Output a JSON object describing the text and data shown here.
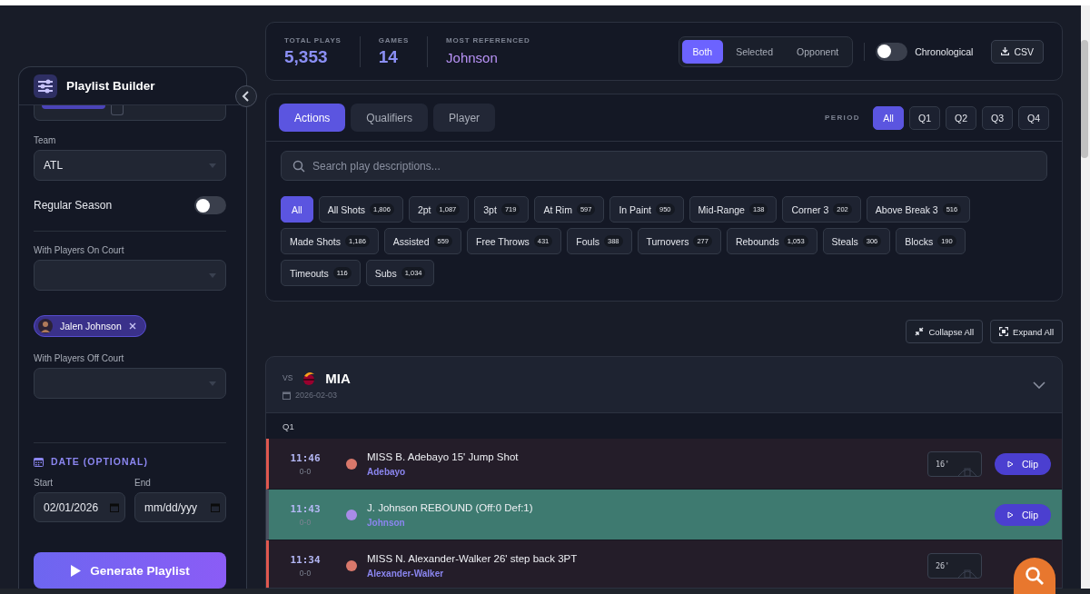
{
  "sidebar": {
    "title": "Playlist Builder",
    "team": {
      "label": "Team",
      "value": "ATL"
    },
    "regular_season": {
      "label": "Regular Season",
      "on": false
    },
    "on_court": {
      "label": "With Players On Court",
      "chips": [
        "Jalen Johnson"
      ]
    },
    "off_court": {
      "label": "With Players Off Court"
    },
    "date": {
      "heading": "DATE (OPTIONAL)",
      "start": {
        "label": "Start",
        "value": "02/01/2026"
      },
      "end": {
        "label": "End",
        "placeholder": "mm/dd/yyy"
      }
    },
    "generate_button": "Generate Playlist"
  },
  "stats": [
    {
      "label": "TOTAL PLAYS",
      "value": "5,353"
    },
    {
      "label": "GAMES",
      "value": "14"
    },
    {
      "label": "MOST REFERENCED",
      "value": "Johnson",
      "kind": "name"
    }
  ],
  "scope": [
    {
      "label": "Both",
      "selected": true
    },
    {
      "label": "Selected",
      "selected": false
    },
    {
      "label": "Opponent",
      "selected": false
    }
  ],
  "chronological": {
    "label": "Chronological",
    "on": false
  },
  "csv_button": "CSV",
  "tabs": [
    {
      "label": "Actions",
      "selected": true
    },
    {
      "label": "Qualifiers",
      "selected": false
    },
    {
      "label": "Player",
      "selected": false
    }
  ],
  "period": {
    "label": "PERIOD",
    "options": [
      {
        "label": "All",
        "selected": true
      },
      {
        "label": "Q1",
        "selected": false
      },
      {
        "label": "Q2",
        "selected": false
      },
      {
        "label": "Q3",
        "selected": false
      },
      {
        "label": "Q4",
        "selected": false
      }
    ]
  },
  "search": {
    "placeholder": "Search play descriptions..."
  },
  "filters": [
    {
      "label": "All",
      "selected": true
    },
    {
      "label": "All Shots",
      "count": "1,806",
      "selected": false
    },
    {
      "label": "2pt",
      "count": "1,087",
      "selected": false
    },
    {
      "label": "3pt",
      "count": "719",
      "selected": false
    },
    {
      "label": "At Rim",
      "count": "597",
      "selected": false
    },
    {
      "label": "In Paint",
      "count": "950",
      "selected": false
    },
    {
      "label": "Mid-Range",
      "count": "138",
      "selected": false
    },
    {
      "label": "Corner 3",
      "count": "202",
      "selected": false
    },
    {
      "label": "Above Break 3",
      "count": "516",
      "selected": false
    },
    {
      "label": "Made Shots",
      "count": "1,186",
      "selected": false
    },
    {
      "label": "Assisted",
      "count": "559",
      "selected": false
    },
    {
      "label": "Free Throws",
      "count": "431",
      "selected": false
    },
    {
      "label": "Fouls",
      "count": "388",
      "selected": false
    },
    {
      "label": "Turnovers",
      "count": "277",
      "selected": false
    },
    {
      "label": "Rebounds",
      "count": "1,053",
      "selected": false
    },
    {
      "label": "Steals",
      "count": "306",
      "selected": false
    },
    {
      "label": "Blocks",
      "count": "190",
      "selected": false
    },
    {
      "label": "Timeouts",
      "count": "116",
      "selected": false
    },
    {
      "label": "Subs",
      "count": "1,034",
      "selected": false
    }
  ],
  "collapse_button": "Collapse All",
  "expand_button": "Expand All",
  "game": {
    "vs": "VS",
    "team": "MIA",
    "date": "2026-02-03",
    "expanded": true,
    "period": "Q1",
    "plays": [
      {
        "time": "11:46",
        "score": "0-0",
        "color": "#d9786b",
        "description": "MISS B. Adebayo 15' Jump Shot",
        "player": "Adebayo",
        "distance": "16'",
        "kind": "miss",
        "selected": false,
        "clip": "Clip"
      },
      {
        "time": "11:43",
        "score": "0-0",
        "color": "#a98be8",
        "description": "J. Johnson REBOUND (Off:0 Def:1)",
        "player": "Johnson",
        "kind": "other",
        "selected": true,
        "clip": "Clip"
      },
      {
        "time": "11:34",
        "score": "0-0",
        "color": "#d9786b",
        "description": "MISS N. Alexander-Walker 26' step back 3PT",
        "player": "Alexander-Walker",
        "distance": "26'",
        "kind": "miss",
        "selected": false
      }
    ]
  }
}
